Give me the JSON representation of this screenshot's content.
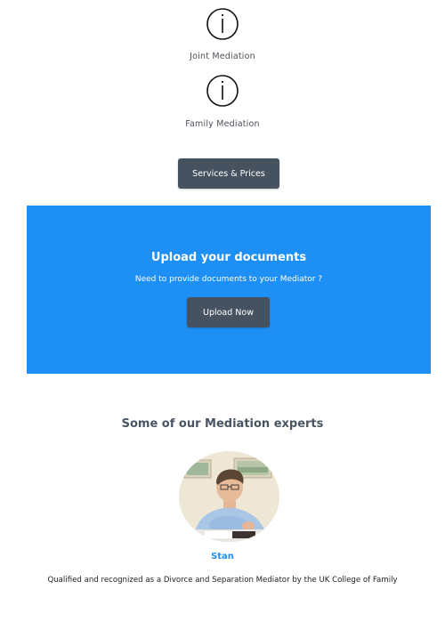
{
  "services": {
    "items": [
      {
        "label": "Joint Mediation",
        "icon": "info-icon"
      },
      {
        "label": "Family Mediation",
        "icon": "info-icon"
      }
    ],
    "button_label": "Services & Prices"
  },
  "upload": {
    "title": "Upload your documents",
    "subtitle": "Need to provide documents to your Mediator ?",
    "button_label": "Upload Now",
    "background_color": "#1e8ff5"
  },
  "experts": {
    "heading": "Some of our Mediation experts",
    "name": "Stan",
    "description": "Qualified and recognized as a Divorce and Separation Mediator by the UK College of Family"
  },
  "colors": {
    "button": "#475260",
    "accent": "#1e8ff5"
  }
}
